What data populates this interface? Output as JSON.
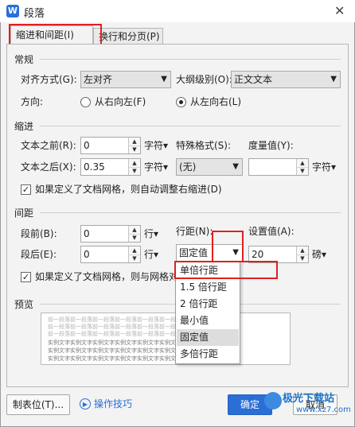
{
  "window": {
    "title": "段落",
    "icon": "wps-writer-icon"
  },
  "tabs": [
    {
      "label": "缩进和间距(I)",
      "active": true
    },
    {
      "label": "换行和分页(P)",
      "active": false
    }
  ],
  "general": {
    "heading": "常规",
    "alignment_label": "对齐方式(G):",
    "alignment_value": "左对齐",
    "outline_label": "大纲级别(O):",
    "outline_value": "正文文本",
    "direction_label": "方向:",
    "rtl_label": "从右向左(F)",
    "ltr_label": "从左向右(L)"
  },
  "indent": {
    "heading": "缩进",
    "before_label": "文本之前(R):",
    "before_value": "0",
    "before_unit": "字符▾",
    "special_label": "特殊格式(S):",
    "special_value": "(无)",
    "measure_label": "度量值(Y):",
    "measure_value": "",
    "measure_unit": "字符▾",
    "after_label": "文本之后(X):",
    "after_value": "0.35",
    "after_unit": "字符▾",
    "grid_check_label": "如果定义了文档网格，则自动调整右缩进(D)"
  },
  "spacing": {
    "heading": "间距",
    "before_label": "段前(B):",
    "before_value": "0",
    "before_unit": "行▾",
    "after_label": "段后(E):",
    "after_value": "0",
    "after_unit": "行▾",
    "line_label": "行距(N):",
    "line_value": "固定值",
    "set_label": "设置值(A):",
    "set_value": "20",
    "set_unit": "磅▾",
    "grid_check_label": "如果定义了文档网格，则与网格对"
  },
  "line_spacing_menu": {
    "options": [
      "单倍行距",
      "1.5 倍行距",
      "2 倍行距",
      "最小值",
      "固定值",
      "多倍行距"
    ],
    "selected": "固定值"
  },
  "preview": {
    "heading": "预览",
    "prev_text": "前一段落前一段落前一段落前一段落前一段落前一段落前一段落",
    "sample_text": "实例文字实例文字实例文字实例文字实例文字实例文字实例文字"
  },
  "footer": {
    "tabs_button": "制表位(T)...",
    "tips_link": "操作技巧",
    "ok_button": "确定",
    "cancel_button": "取消"
  },
  "watermark": {
    "brand": "极光下载站",
    "url": "www.xz7.com"
  },
  "colors": {
    "accent": "#2b6ed6",
    "highlight_red": "#e02020"
  }
}
